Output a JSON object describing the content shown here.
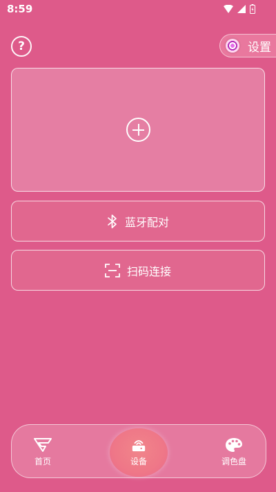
{
  "status_bar": {
    "time": "8:59"
  },
  "header": {
    "help_label": "?",
    "settings_label": "设置"
  },
  "actions": {
    "bluetooth_label": "蓝牙配对",
    "scan_label": "扫码连接"
  },
  "bottom_nav": {
    "home_label": "首页",
    "device_label": "设备",
    "palette_label": "调色盘",
    "active": "设备"
  }
}
